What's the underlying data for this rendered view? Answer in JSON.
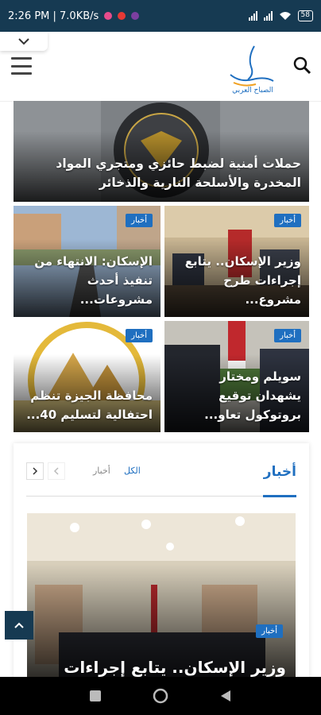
{
  "status_bar": {
    "time_speed": "2:26 PM | 7.0KB/s",
    "battery": "58"
  },
  "header": {
    "logo_label": "الصباح العربي"
  },
  "hero": {
    "title": "حملات أمنية لضبط حائزي ومتجري المواد المخدرة والأسلحة النارية والذخائر"
  },
  "grid": [
    {
      "tag": "أخبار",
      "title": "وزير الإسكان.. يتابع إجراءات طرح مشروع..."
    },
    {
      "tag": "أخبار",
      "title": "الإسكان: الانتهاء من تنفيذ أحدث مشروعات..."
    },
    {
      "tag": "أخبار",
      "title": "سويلم ومختار يشهدان توقيع بروتوكول تعاو..."
    },
    {
      "tag": "أخبار",
      "title": "محافظة الجيزة تنظم احتفالية لتسليم 40..."
    }
  ],
  "news_section": {
    "title": "أخبار",
    "filter_all": "الكل",
    "filter_news": "أخبار",
    "feature_tag": "أخبار",
    "feature_title": "وزير الإسكان.. يتابع إجراءات"
  },
  "colors": {
    "status_bar": "#163a52",
    "accent": "#1f6fc0",
    "tag_bg": "#1f6fc0"
  }
}
